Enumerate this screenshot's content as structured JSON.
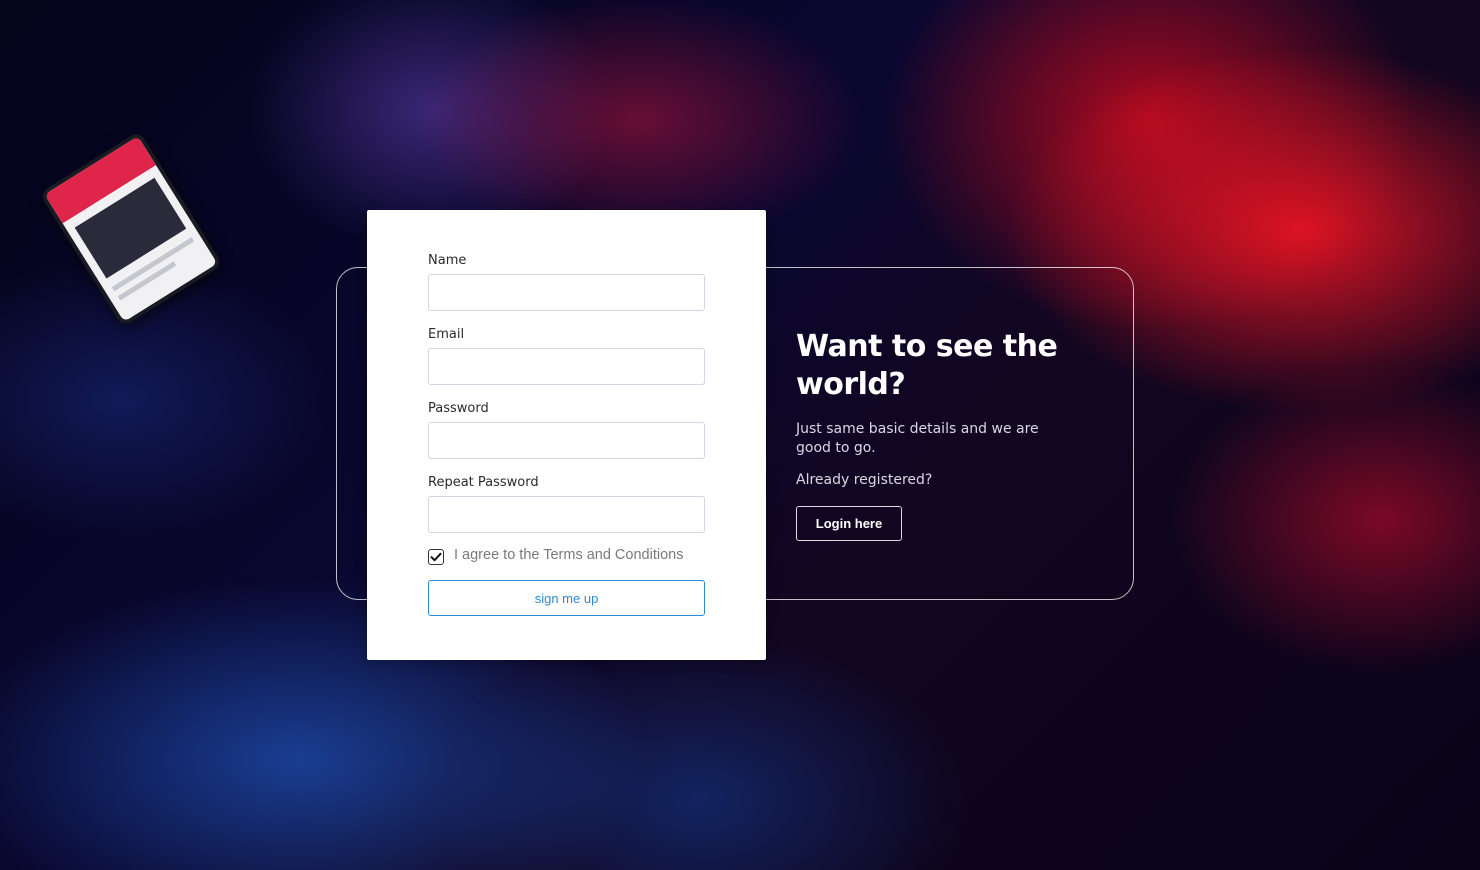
{
  "colors": {
    "accent": "#2d8ad8",
    "card_background": "#ffffff",
    "background_red": "#e6141f",
    "background_navy": "#0a0730"
  },
  "form": {
    "name_label": "Name",
    "name_value": "",
    "email_label": "Email",
    "email_value": "",
    "password_label": "Password",
    "password_value": "",
    "repeat_password_label": "Repeat Password",
    "repeat_password_value": "",
    "terms_checked": true,
    "terms_label": "I agree to the Terms and Conditions",
    "submit_label": "sign me up"
  },
  "promo": {
    "title": "Want to see the world?",
    "description": "Just same basic details and we are good to go.",
    "already_registered": "Already registered?",
    "login_label": "Login here"
  },
  "icons": {
    "checkbox_mark": "checkmark-icon"
  }
}
